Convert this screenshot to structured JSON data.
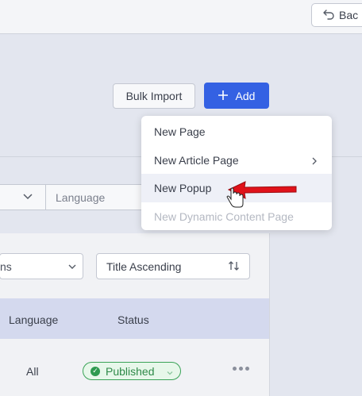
{
  "topbar": {
    "back_label": "Bac"
  },
  "actions": {
    "bulk_import_label": "Bulk Import",
    "add_label": "Add"
  },
  "filters": {
    "language_placeholder": "Language"
  },
  "table": {
    "sort_left_label": "ns",
    "sort_label": "Title Ascending",
    "columns": {
      "language": "Language",
      "status": "Status"
    },
    "row": {
      "language": "All",
      "status": "Published"
    }
  },
  "menu": {
    "items": [
      {
        "label": "New Page"
      },
      {
        "label": "New Article Page"
      },
      {
        "label": "New Popup"
      },
      {
        "label": "New Dynamic Content Page"
      }
    ]
  },
  "colors": {
    "accent": "#3461e3",
    "published_green": "#2f8a49",
    "header_bg": "#d4d9ee",
    "arrow_red": "#e0121a"
  }
}
